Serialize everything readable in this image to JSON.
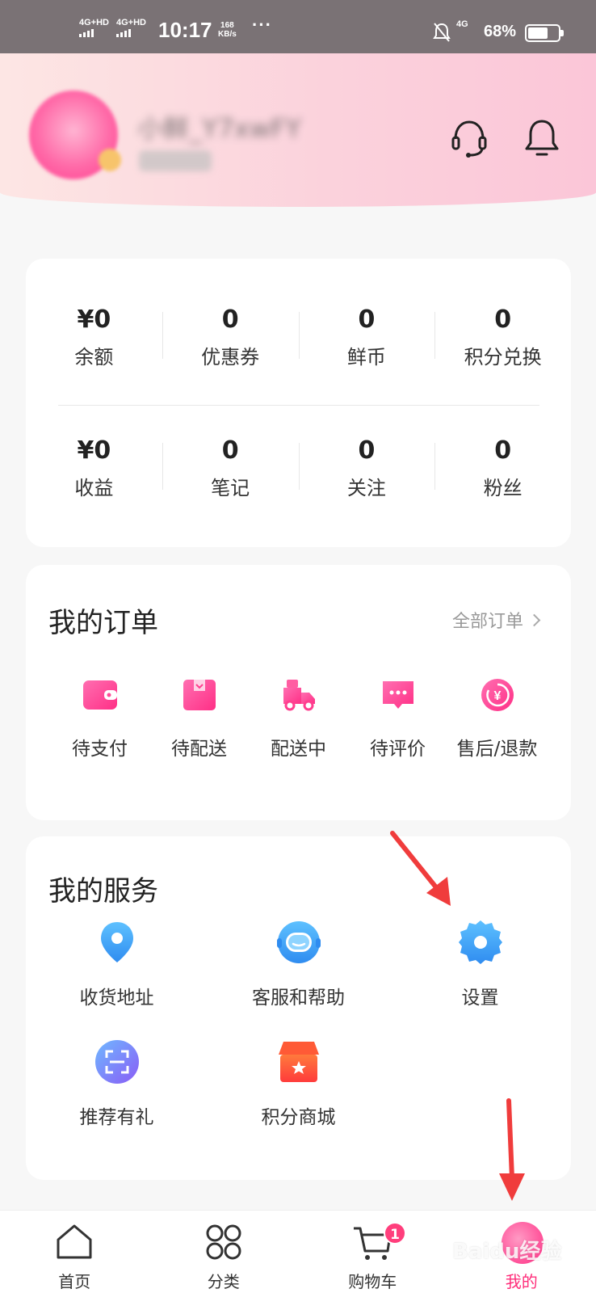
{
  "status_bar": {
    "sim1": "4G+HD",
    "sim2": "4G+HD",
    "time": "10:17",
    "speed_value": "168",
    "speed_unit": "KB/s",
    "more": "···",
    "network": "4G",
    "battery": "68%",
    "battery_level": 0.68
  },
  "header": {
    "username": "小鲜_Y7xwFY",
    "support_icon": "headset-icon",
    "bell_icon": "bell-icon"
  },
  "stats": {
    "row1": [
      {
        "value": "¥0",
        "label": "余额"
      },
      {
        "value": "0",
        "label": "优惠券"
      },
      {
        "value": "0",
        "label": "鲜币"
      },
      {
        "value": "0",
        "label": "积分兑换"
      }
    ],
    "row2": [
      {
        "value": "¥0",
        "label": "收益"
      },
      {
        "value": "0",
        "label": "笔记"
      },
      {
        "value": "0",
        "label": "关注"
      },
      {
        "value": "0",
        "label": "粉丝"
      }
    ]
  },
  "orders": {
    "title": "我的订单",
    "all_label": "全部订单",
    "items": [
      {
        "label": "待支付",
        "icon": "wallet-icon"
      },
      {
        "label": "待配送",
        "icon": "package-icon"
      },
      {
        "label": "配送中",
        "icon": "delivery-truck-icon"
      },
      {
        "label": "待评价",
        "icon": "comment-icon"
      },
      {
        "label": "售后/退款",
        "icon": "refund-icon"
      }
    ]
  },
  "services": {
    "title": "我的服务",
    "items": [
      {
        "label": "收货地址",
        "icon": "location-pin-icon"
      },
      {
        "label": "客服和帮助",
        "icon": "customer-service-icon"
      },
      {
        "label": "设置",
        "icon": "gear-icon"
      },
      {
        "label": "推荐有礼",
        "icon": "scan-icon"
      },
      {
        "label": "积分商城",
        "icon": "store-icon"
      }
    ]
  },
  "bottom_nav": {
    "items": [
      {
        "label": "首页",
        "icon": "home-icon"
      },
      {
        "label": "分类",
        "icon": "category-grid-icon"
      },
      {
        "label": "购物车",
        "icon": "cart-icon",
        "badge": "1"
      },
      {
        "label": "我的",
        "icon": "profile-icon",
        "active": true
      }
    ]
  },
  "watermark": "Baidu经验",
  "colors": {
    "accent": "#ff2d7a",
    "service_blue": "#3aa5f5",
    "header_gradient_start": "#fde6e4",
    "header_gradient_end": "#fbc6d8",
    "annotation_red": "#f03c3c"
  }
}
